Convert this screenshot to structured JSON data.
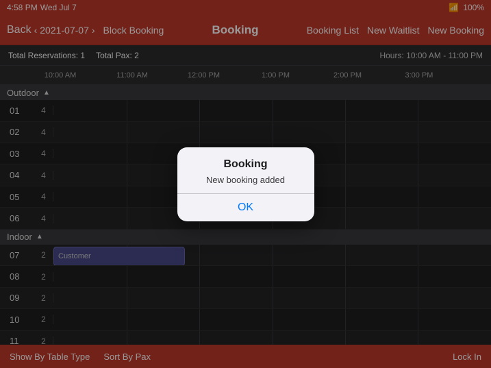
{
  "status_bar": {
    "time": "4:58 PM",
    "date": "Wed Jul 7",
    "wifi_icon": "wifi",
    "battery": "100%"
  },
  "nav_bar": {
    "back_label": "Back",
    "date": "2021-07-07",
    "block_booking_label": "Block Booking",
    "title": "Booking",
    "booking_list_label": "Booking List",
    "new_waitlist_label": "New Waitlist",
    "new_booking_label": "New Booking"
  },
  "info_bar": {
    "reservations_label": "Total Reservations:",
    "reservations_value": "1",
    "pax_label": "Total Pax:",
    "pax_value": "2",
    "hours_label": "Hours:",
    "hours_value": "10:00 AM - 11:00 PM"
  },
  "timeline": {
    "ticks": [
      {
        "label": "10:00 AM",
        "offset_pct": 0
      },
      {
        "label": "11:00 AM",
        "offset_pct": 16.7
      },
      {
        "label": "12:00 PM",
        "offset_pct": 33.3
      },
      {
        "label": "1:00 PM",
        "offset_pct": 50
      },
      {
        "label": "2:00 PM",
        "offset_pct": 66.7
      },
      {
        "label": "3:00 PM",
        "offset_pct": 83.3
      }
    ]
  },
  "sections": [
    {
      "name": "Outdoor",
      "collapsed": false,
      "tables": [
        {
          "id": "01",
          "pax": 4
        },
        {
          "id": "02",
          "pax": 4
        },
        {
          "id": "03",
          "pax": 4
        },
        {
          "id": "04",
          "pax": 4
        },
        {
          "id": "05",
          "pax": 4
        },
        {
          "id": "06",
          "pax": 4
        }
      ]
    },
    {
      "name": "Indoor",
      "collapsed": false,
      "tables": [
        {
          "id": "07",
          "pax": 2,
          "booking": {
            "label": "Customer",
            "left_pct": 0,
            "width_pct": 30
          }
        },
        {
          "id": "08",
          "pax": 2
        },
        {
          "id": "09",
          "pax": 2
        },
        {
          "id": "10",
          "pax": 2
        },
        {
          "id": "11",
          "pax": 2
        }
      ]
    }
  ],
  "modal": {
    "title": "Booking",
    "message": "New booking added",
    "ok_label": "OK"
  },
  "bottom_bar": {
    "show_by_table_type_label": "Show By Table Type",
    "sort_by_pax_label": "Sort By Pax",
    "lock_in_label": "Lock In"
  }
}
